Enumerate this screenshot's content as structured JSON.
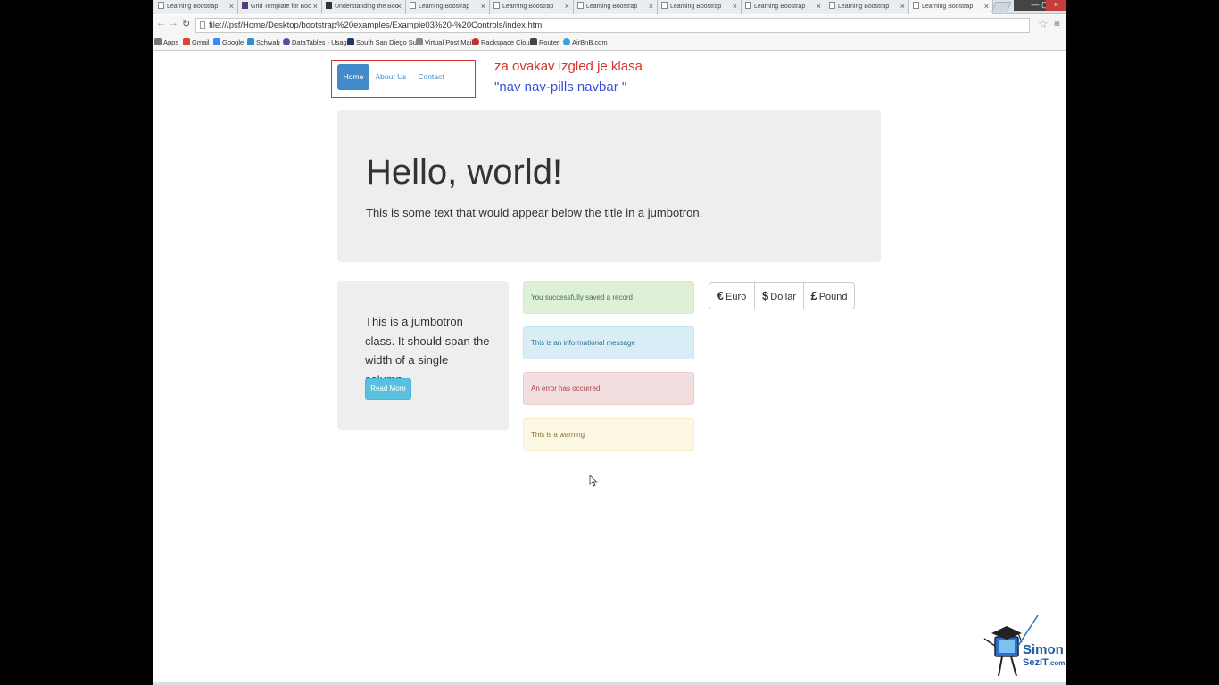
{
  "browser": {
    "tabs": [
      {
        "label": "Learning Boostrap",
        "icon": "page-icon"
      },
      {
        "label": "Grid Template for Boo",
        "icon": "bootstrap-icon"
      },
      {
        "label": "Understanding the Boo",
        "icon": "video-icon"
      },
      {
        "label": "Learning Boostrap",
        "icon": "page-icon"
      },
      {
        "label": "Learning Boostrap",
        "icon": "page-icon"
      },
      {
        "label": "Learning Boostrap",
        "icon": "page-icon"
      },
      {
        "label": "Learning Boostrap",
        "icon": "page-icon"
      },
      {
        "label": "Learning Boostrap",
        "icon": "page-icon"
      },
      {
        "label": "Learning Boostrap",
        "icon": "page-icon"
      },
      {
        "label": "Learning Boostrap",
        "icon": "page-icon"
      }
    ],
    "close_glyph": "×",
    "url": "file:///psf/Home/Desktop/bootstrap%20examples/Example03%20-%20Controls/index.htm",
    "bookmarks": [
      "Apps",
      "Gmail",
      "Google",
      "Schwab",
      "DataTables - Usage",
      "South San Diego Surf",
      "Virtual Post Mail",
      "Rackspace Cloud",
      "Router",
      "AirBnB.com"
    ]
  },
  "nav": {
    "pills": [
      "Home",
      "About Us",
      "Contact"
    ],
    "active": "Home"
  },
  "annotation": {
    "line1": "za ovakav izgled je klasa",
    "line2": "\"nav nav-pills navbar \""
  },
  "jumbotron": {
    "title": "Hello, world!",
    "text": "This is some text that would appear below the title in a jumbotron."
  },
  "column_jumbotron": {
    "text": "This is a jumbotron class. It should span the width of a single column.",
    "button": "Read More"
  },
  "alerts": {
    "success": "You successfully saved a record",
    "info": "This is an informational message",
    "danger": "An error has occurred",
    "warning": "This is a warning"
  },
  "currency_buttons": [
    {
      "symbol": "€",
      "label": "Euro"
    },
    {
      "symbol": "$",
      "label": "Dollar"
    },
    {
      "symbol": "£",
      "label": "Pound"
    }
  ],
  "logo": {
    "line1": "Simon",
    "line2": "SezIT",
    "line3": ".com"
  },
  "colors": {
    "primary": "#428bca",
    "info": "#5bc0de",
    "annotation_red": "#d6342a",
    "annotation_blue": "#3a4fd6"
  }
}
